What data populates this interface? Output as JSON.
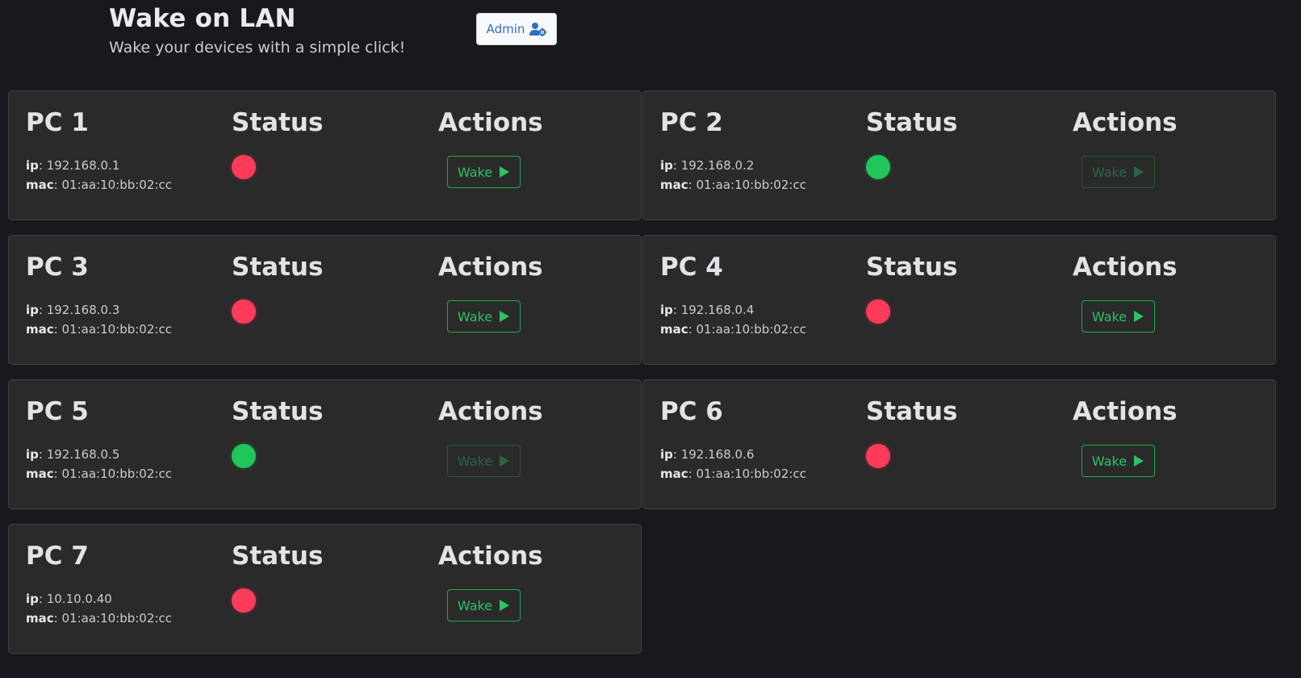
{
  "header": {
    "title": "Wake on LAN",
    "subtitle": "Wake your devices with a simple click!",
    "admin_label": "Admin",
    "admin_icon": "user-gear-icon"
  },
  "labels": {
    "status": "Status",
    "actions": "Actions",
    "ip": "ip",
    "mac": "mac",
    "wake": "Wake",
    "wake_icon": "play-icon"
  },
  "colors": {
    "background": "#18191c",
    "card": "#2a2a2b",
    "offline": "#ff3b5c",
    "online": "#21c65a",
    "wake_green": "#2ec262",
    "admin_blue": "#2f6fbf"
  },
  "devices": [
    {
      "name": "PC 1",
      "ip": "192.168.0.1",
      "mac": "01:aa:10:bb:02:cc",
      "status": "offline",
      "wake_enabled": true
    },
    {
      "name": "PC 2",
      "ip": "192.168.0.2",
      "mac": "01:aa:10:bb:02:cc",
      "status": "online",
      "wake_enabled": false
    },
    {
      "name": "PC 3",
      "ip": "192.168.0.3",
      "mac": "01:aa:10:bb:02:cc",
      "status": "offline",
      "wake_enabled": true
    },
    {
      "name": "PC 4",
      "ip": "192.168.0.4",
      "mac": "01:aa:10:bb:02:cc",
      "status": "offline",
      "wake_enabled": true
    },
    {
      "name": "PC 5",
      "ip": "192.168.0.5",
      "mac": "01:aa:10:bb:02:cc",
      "status": "online",
      "wake_enabled": false
    },
    {
      "name": "PC 6",
      "ip": "192.168.0.6",
      "mac": "01:aa:10:bb:02:cc",
      "status": "offline",
      "wake_enabled": true
    },
    {
      "name": "PC 7",
      "ip": "10.10.0.40",
      "mac": "01:aa:10:bb:02:cc",
      "status": "offline",
      "wake_enabled": true
    }
  ]
}
